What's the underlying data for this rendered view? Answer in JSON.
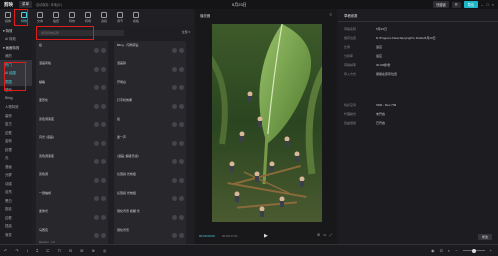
{
  "titlebar": {
    "app_name": "剪映",
    "menu_label": "菜单",
    "autosave": "自动保存: 本地(D:)",
    "window_title": "5月23日",
    "shortcut": "快捷键",
    "layout_btn": "导出",
    "export_label": "导出"
  },
  "tooltabs": [
    {
      "label": "媒体",
      "active": false
    },
    {
      "label": "特效",
      "active": true
    },
    {
      "label": "文本",
      "active": false
    },
    {
      "label": "贴纸",
      "active": false
    },
    {
      "label": "特效",
      "active": false
    },
    {
      "label": "转场",
      "active": false
    },
    {
      "label": "滤镜",
      "active": false
    },
    {
      "label": "调节",
      "active": false
    },
    {
      "label": "模板",
      "active": false
    }
  ],
  "leftnav": [
    {
      "label": "▾ 特效",
      "type": "head"
    },
    {
      "label": "AI 特效",
      "type": "item"
    },
    {
      "label": "▾ 画面特效",
      "type": "head"
    },
    {
      "label": "我的",
      "type": "item"
    },
    {
      "label": "热门",
      "type": "sel"
    },
    {
      "label": "AI 绘图",
      "type": "sel"
    },
    {
      "label": "氛围",
      "type": "sel"
    },
    {
      "label": "基础",
      "type": "item"
    },
    {
      "label": "Bling",
      "type": "item"
    },
    {
      "label": "人物特效",
      "type": "item"
    },
    {
      "label": "装饰",
      "type": "item"
    },
    {
      "label": "复古",
      "type": "item"
    },
    {
      "label": "边框",
      "type": "item"
    },
    {
      "label": "金粉",
      "type": "item"
    },
    {
      "label": "纹理",
      "type": "item"
    },
    {
      "label": "光",
      "type": "item"
    },
    {
      "label": "漫画",
      "type": "item"
    },
    {
      "label": "分屏",
      "type": "item"
    },
    {
      "label": "动感",
      "type": "item"
    },
    {
      "label": "自然",
      "type": "item"
    },
    {
      "label": "黑白",
      "type": "item"
    },
    {
      "label": "投影",
      "type": "item"
    },
    {
      "label": "边框",
      "type": "item"
    },
    {
      "label": "扭曲",
      "type": "item"
    },
    {
      "label": "渐变",
      "type": "item"
    }
  ],
  "effects": {
    "search_placeholder": "搜索特效名称",
    "filter_label": "全部",
    "cards": [
      {
        "name": "摇",
        "sub": ""
      },
      {
        "name": "Bling · 闪烁碎钻",
        "sub": ""
      },
      {
        "name": "漫画风格",
        "sub": ""
      },
      {
        "name": "漫画铁",
        "sub": ""
      },
      {
        "name": "蝴蝶",
        "sub": ""
      },
      {
        "name": "开场白",
        "sub": ""
      },
      {
        "name": "变形化",
        "sub": ""
      },
      {
        "name": "打字机效果",
        "sub": ""
      },
      {
        "name": "双色调渐变",
        "sub": ""
      },
      {
        "name": "摇",
        "sub": ""
      },
      {
        "name": "闪光 (漫画)",
        "sub": ""
      },
      {
        "name": "迷一声",
        "sub": ""
      },
      {
        "name": "双色调渐变",
        "sub": ""
      },
      {
        "name": "(漫画, 超级灵感)",
        "sub": ""
      },
      {
        "name": "双色调",
        "sub": ""
      },
      {
        "name": "氛围感 光效组",
        "sub": ""
      },
      {
        "name": "一键抽帧",
        "sub": ""
      },
      {
        "name": "氛围感 光效组",
        "sub": ""
      },
      {
        "name": "迷你光",
        "sub": ""
      },
      {
        "name": "弱化背景 模糊 光",
        "sub": ""
      },
      {
        "name": "马赛克",
        "sub": "Random · 1.8"
      },
      {
        "name": "弱化背景",
        "sub": ""
      }
    ]
  },
  "preview": {
    "title": "播放器",
    "timecode_current": "00:00:00:00",
    "timecode_total": "00:00:17:01"
  },
  "rpanel": {
    "title": "草稿参数",
    "rows": [
      {
        "k": "草稿名称",
        "v": "5月23日"
      },
      {
        "k": "保存位置",
        "v": "D:/Program Files/JianyingPro Drafts/5月23日"
      },
      {
        "k": "比例",
        "v": "适应"
      },
      {
        "k": "分辨率",
        "v": "适应"
      },
      {
        "k": "草稿帧率",
        "v": "30.00帧/秒"
      },
      {
        "k": "导入方式",
        "v": "保留在原有位置"
      },
      {
        "k": "色彩空间",
        "v": "SDR - Rec.709"
      },
      {
        "k": "代理模式",
        "v": "未开启"
      },
      {
        "k": "自由层级",
        "v": "已开启"
      }
    ],
    "edit_label": "修改"
  },
  "timeline": {
    "icons": [
      "↶",
      "↷",
      "I",
      "⌶",
      "⊏",
      "⊓",
      "⊟",
      "⊞",
      "⊕",
      "◎"
    ],
    "right_icons": [
      "🎙",
      "⊡",
      "◐",
      "−"
    ]
  }
}
